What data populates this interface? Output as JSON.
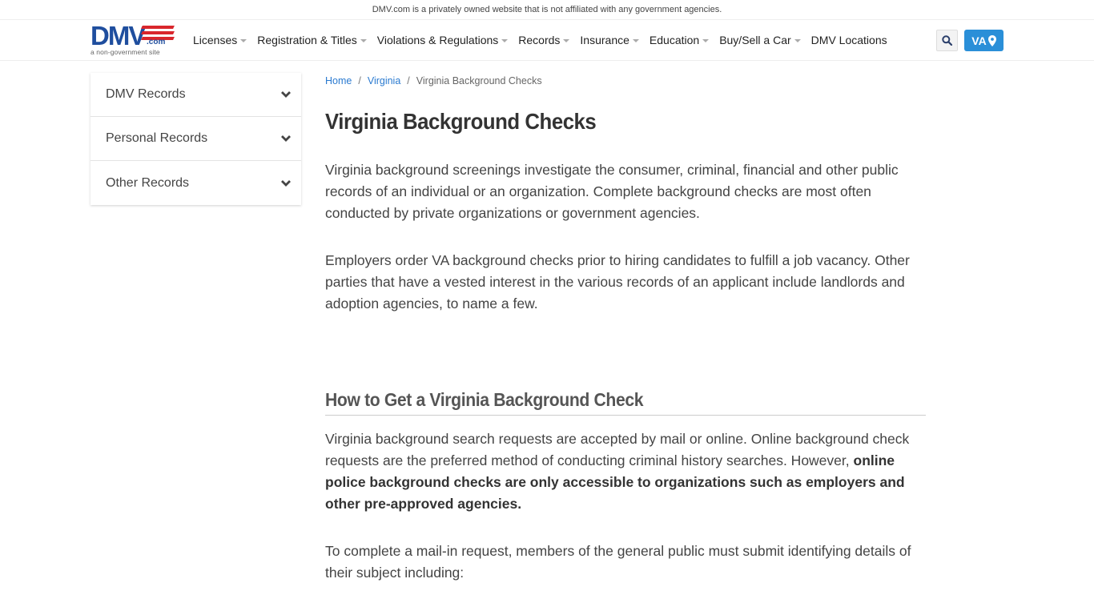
{
  "topbar": {
    "disclaimer": "DMV.com is a privately owned website that is not affiliated with any government agencies."
  },
  "header": {
    "logo": {
      "main": "DMV",
      "suffix": ".com",
      "tagline": "a non-government site"
    },
    "nav": [
      {
        "label": "Licenses",
        "dropdown": true
      },
      {
        "label": "Registration & Titles",
        "dropdown": true
      },
      {
        "label": "Violations & Regulations",
        "dropdown": true
      },
      {
        "label": "Records",
        "dropdown": true
      },
      {
        "label": "Insurance",
        "dropdown": true
      },
      {
        "label": "Education",
        "dropdown": true
      },
      {
        "label": "Buy/Sell a Car",
        "dropdown": true
      },
      {
        "label": "DMV Locations",
        "dropdown": false
      }
    ],
    "search_icon": "search-icon",
    "state_button": {
      "label": "VA",
      "icon": "map-marker-icon"
    }
  },
  "colors": {
    "brand_blue": "#1f4e9e",
    "brand_red": "#d9262c",
    "accent": "#2a8fd8",
    "link": "#2a7ad0"
  },
  "sidebar": {
    "items": [
      {
        "label": "DMV Records",
        "icon": "chevron-down-icon"
      },
      {
        "label": "Personal Records",
        "icon": "chevron-down-icon"
      },
      {
        "label": "Other Records",
        "icon": "chevron-down-icon"
      }
    ]
  },
  "main": {
    "breadcrumb": [
      {
        "label": "Home",
        "link": true
      },
      {
        "label": "Virginia",
        "link": true
      },
      {
        "label": "Virginia Background Checks",
        "link": false
      }
    ],
    "breadcrumb_separator": "/",
    "title": "Virginia Background Checks",
    "paragraphs": [
      "Virginia background screenings investigate the consumer, criminal, financial and other public records of an individual or an organization. Complete background checks are most often conducted by private organizations or government agencies.",
      "Employers order VA background checks prior to hiring candidates to fulfill a job vacancy. Other parties that have a vested interest in the various records of an applicant include landlords and adoption agencies, to name a few."
    ],
    "section": {
      "heading": "How to Get a Virginia Background Check",
      "p1_plain": "Virginia background search requests are accepted by mail or online. Online background check requests are the preferred method of conducting criminal history searches. However, ",
      "p1_bold": "online police background checks are only accessible to organizations such as employers and other pre-approved agencies.",
      "p2": "To complete a mail-in request, members of the general public must submit identifying details of their subject including:"
    }
  }
}
